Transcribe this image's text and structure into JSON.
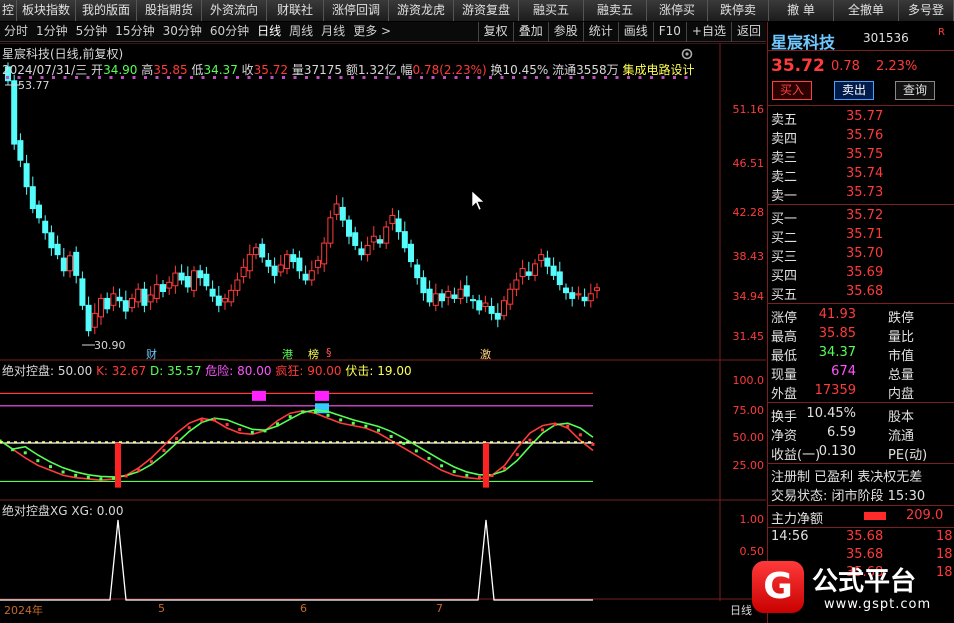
{
  "toolbar": [
    "控",
    "板块指数",
    "我的版面",
    "股指期货",
    "外资流向",
    "财联社",
    "涨停回调",
    "游资龙虎",
    "游资复盘",
    "融买五",
    "融卖五",
    "涨停买",
    "跌停卖",
    "撤 单",
    "全撤单",
    "多号登"
  ],
  "tabs": [
    "分时",
    "1分钟",
    "5分钟",
    "15分钟",
    "30分钟",
    "60分钟",
    "日线",
    "周线",
    "月线",
    "更多 >"
  ],
  "active_tab": "日线",
  "right_tabs": [
    "复权",
    "叠加",
    "参股",
    "统计",
    "画线",
    "F10",
    "+自选",
    "返回"
  ],
  "header": {
    "title": "星宸科技(日线,前复权)",
    "date": "2024/07/31/三",
    "open_l": "开",
    "open": "34.90",
    "high_l": "高",
    "high": "35.85",
    "low_l": "低",
    "low": "34.37",
    "close_l": "收",
    "close": "35.72",
    "vol_l": "量",
    "vol": "37175",
    "amt_l": "额",
    "amt": "1.32亿",
    "amp_l": "幅",
    "amp": "0.78(2.23%)",
    "turn_l": "换",
    "turn": "10.45%",
    "float_l": "流通",
    "float": "3558万",
    "sector": "集成电路设计"
  },
  "price_axis": [
    "51.16",
    "46.51",
    "42.28",
    "38.43",
    "34.94",
    "31.45"
  ],
  "price_max": "53.77",
  "price_min": "30.90",
  "event_tags": [
    {
      "t": "财",
      "color": "#6fc8ff"
    },
    {
      "t": "港",
      "color": "#55ff55"
    },
    {
      "t": "榜",
      "color": "#ffff55"
    },
    {
      "t": "§",
      "color": "#ff5555"
    },
    {
      "t": "激",
      "color": "#ffd080"
    }
  ],
  "ind1": {
    "name": "绝对控盘",
    "param": ": 50.00",
    "k_l": "K: ",
    "k": "32.67",
    "d_l": "D: ",
    "d": "35.57",
    "danger_l": "危险: ",
    "danger": "80.00",
    "crazy_l": "疯狂: ",
    "crazy": "90.00",
    "ambush_l": "伏击: ",
    "ambush": "19.00"
  },
  "ind1_axis": [
    "100.0",
    "75.00",
    "50.00",
    "25.00"
  ],
  "ind2": {
    "name": "绝对控盘XG",
    "xg": "XG: 0.00"
  },
  "ind2_axis": [
    "1.00",
    "0.50"
  ],
  "x_axis": [
    "2024年",
    "5",
    "6",
    "7"
  ],
  "x_end": "日线",
  "quote": {
    "name": "星宸科技",
    "code": "301536",
    "r": "R",
    "price": "35.72",
    "chg": "0.78",
    "pct": "2.23%",
    "buy_btn": "买入",
    "sell_btn": "卖出",
    "query_btn": "查询",
    "sells": [
      {
        "label": "卖五",
        "price": "35.77"
      },
      {
        "label": "卖四",
        "price": "35.76"
      },
      {
        "label": "卖三",
        "price": "35.75"
      },
      {
        "label": "卖二",
        "price": "35.74"
      },
      {
        "label": "卖一",
        "price": "35.73"
      }
    ],
    "buys": [
      {
        "label": "买一",
        "price": "35.72"
      },
      {
        "label": "买二",
        "price": "35.71"
      },
      {
        "label": "买三",
        "price": "35.70"
      },
      {
        "label": "买四",
        "price": "35.69"
      },
      {
        "label": "买五",
        "price": "35.68"
      }
    ],
    "stats": [
      {
        "l": "涨停",
        "v": "41.93",
        "r": "跌停",
        "vc": "#ff3b3b"
      },
      {
        "l": "最高",
        "v": "35.85",
        "r": "量比",
        "vc": "#ff3b3b"
      },
      {
        "l": "最低",
        "v": "34.37",
        "r": "市值",
        "vc": "#55ff55"
      },
      {
        "l": "现量",
        "v": "674",
        "r": "总量",
        "vc": "#ff55ff"
      },
      {
        "l": "外盘",
        "v": "17359",
        "r": "内盘",
        "vc": "#ff3b3b"
      }
    ],
    "stats2": [
      {
        "l": "换手",
        "v": "10.45%",
        "r": "股本",
        "vc": "#e0e0e0"
      },
      {
        "l": "净资",
        "v": "6.59",
        "r": "流通",
        "vc": "#e0e0e0"
      },
      {
        "l": "收益(一)",
        "v": "0.130",
        "r": "PE(动)",
        "vc": "#e0e0e0"
      }
    ],
    "info1": "注册制 已盈利 表决权无差",
    "info2": "交易状态: 闭市阶段 15:30",
    "main_l": "主力净额",
    "main_v": "209.0",
    "ticks": [
      {
        "t": "14:56",
        "p": "35.68",
        "v": "18"
      },
      {
        "t": "",
        "p": "35.68",
        "v": "18"
      },
      {
        "t": "",
        "p": "35.68",
        "v": "18"
      }
    ]
  },
  "logo": {
    "glyph": "G",
    "title": "公式平台",
    "url": "www.gspt.com"
  }
}
